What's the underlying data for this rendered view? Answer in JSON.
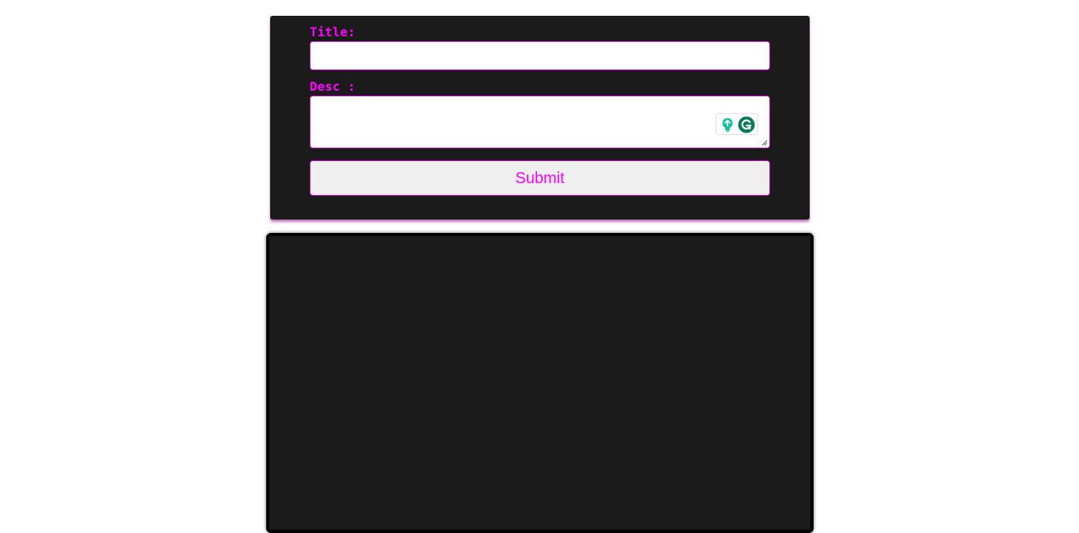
{
  "form": {
    "title_label": "Title:",
    "title_value": "",
    "desc_label": "Desc :",
    "desc_value": "",
    "submit_label": "Submit"
  },
  "colors": {
    "accent": "#ff00ff",
    "card_background": "#1b1b1b",
    "page_background": "#ffffff",
    "grammarly_green": "#15c39a",
    "grammarly_dark_green": "#0a7a5a"
  },
  "icons": {
    "grammarly_widget": [
      "lightbulb-icon",
      "grammarly-logo-icon"
    ],
    "textarea": "resize-grip-icon"
  },
  "notes_list": {
    "items": []
  }
}
